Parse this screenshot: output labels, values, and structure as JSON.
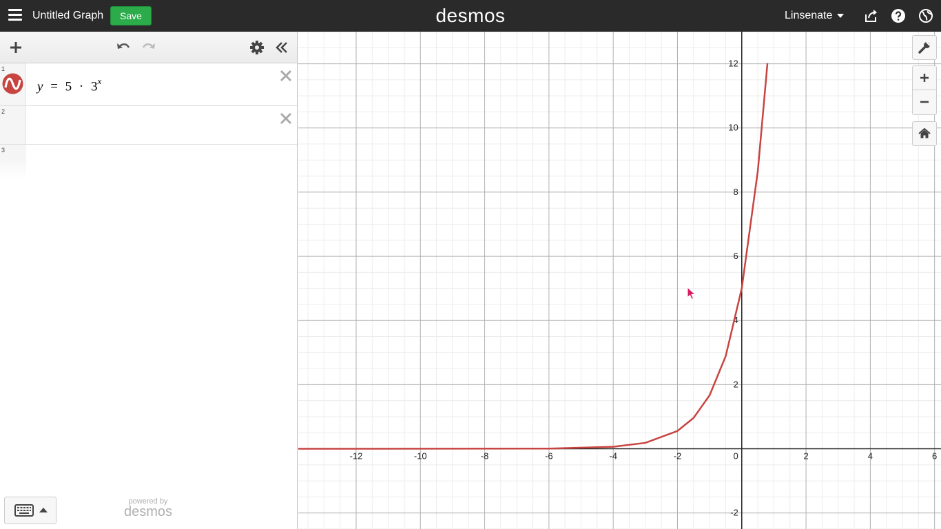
{
  "topbar": {
    "menu_icon": "hamburger-menu-icon",
    "graph_title": "Untitled Graph",
    "save_label": "Save",
    "brand": "desmos",
    "user_name": "Linsenate",
    "icons": [
      "share-icon",
      "help-icon",
      "language-globe-icon"
    ]
  },
  "expressions_toolbar": {
    "icons": [
      "add-item-icon",
      "undo-icon",
      "redo-icon",
      "settings-gear-icon",
      "collapse-panel-icon"
    ]
  },
  "expressions": [
    {
      "index": "1",
      "latex_parts": {
        "y": "y",
        "eq": "=",
        "coef": "5",
        "dot": "·",
        "base": "3",
        "exp": "x"
      },
      "color": "#c74440"
    },
    {
      "index": "2"
    },
    {
      "index": "3"
    }
  ],
  "footer": {
    "powered_by_label": "powered by",
    "powered_by_logo": "desmos",
    "keypad_icons": [
      "keyboard-icon",
      "caret-up-icon"
    ]
  },
  "graph_controls": [
    "wrench-icon",
    "zoom-in-icon",
    "zoom-out-icon",
    "home-icon"
  ],
  "colors": {
    "topbar": "#2a2a2a",
    "save": "#2bab4a",
    "curve": "#c74440"
  },
  "chart_data": {
    "type": "line",
    "function": "y = 5 * 3^x",
    "xlim": [
      -13.8,
      6.2
    ],
    "ylim": [
      -2.5,
      13
    ],
    "x_ticks": [
      -12,
      -10,
      -8,
      -6,
      -4,
      -2,
      2,
      4,
      6
    ],
    "y_ticks": [
      -2,
      2,
      4,
      6,
      8,
      10,
      12
    ],
    "origin_label": "0",
    "grid": true,
    "minor_grid_step": 0.5,
    "major_grid_step": 2,
    "series": [
      {
        "color": "#c74440",
        "x": [
          -13.8,
          -6,
          -4,
          -3,
          -2,
          -1.5,
          -1,
          -0.5,
          0,
          0.5,
          0.8
        ],
        "y": [
          0,
          0.007,
          0.062,
          0.185,
          0.556,
          0.962,
          1.667,
          2.887,
          5,
          8.66,
          12.02
        ]
      }
    ]
  }
}
